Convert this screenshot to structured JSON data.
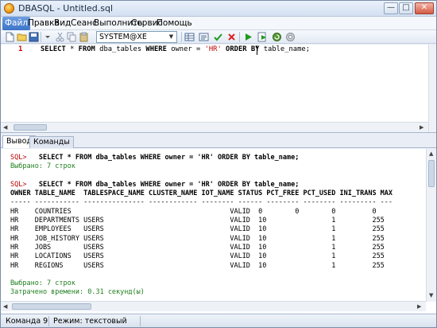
{
  "window": {
    "title": "DBASQL - Untitled.sql"
  },
  "menu": [
    "Файл",
    "Правка",
    "Вид",
    "Сеанс",
    "Выполнить",
    "Сервис",
    "Помощь"
  ],
  "toolbar": {
    "connection": "SYSTEM@XE"
  },
  "editor": {
    "line_number": "1",
    "code": {
      "select": "SELECT",
      "star": " * ",
      "from": "FROM",
      "table": " dba_tables ",
      "where": "WHERE",
      "cond": " owner = ",
      "literal": "'HR'",
      "order": " ORDER ",
      "by": "BY",
      "tail": " table_name;"
    }
  },
  "tabs": [
    {
      "label": "Вывод",
      "active": true
    },
    {
      "label": "Команды",
      "active": false
    }
  ],
  "output": {
    "lines": [
      {
        "type": "sql",
        "prompt": "SQL>",
        "text": "   SELECT * FROM dba_tables WHERE owner = 'HR' ORDER BY table_name;"
      },
      {
        "type": "info",
        "text": "Выбрано: 7 строк"
      },
      {
        "type": "blank",
        "text": ""
      },
      {
        "type": "sql",
        "prompt": "SQL>",
        "text": "   SELECT * FROM dba_tables WHERE owner = 'HR' ORDER BY table_name;"
      },
      {
        "type": "header",
        "text": "OWNER TABLE_NAME  TABLESPACE_NAME CLUSTER_NAME IOT_NAME STATUS PCT_FREE PCT_USED INI_TRANS MAX"
      },
      {
        "type": "row",
        "text": "----- ----------- --------------- ------------ -------- ------ -------- -------- --------- ---"
      },
      {
        "type": "row",
        "text": "HR    COUNTRIES                                       VALID  0        0        0         0"
      },
      {
        "type": "row",
        "text": "HR    DEPARTMENTS USERS                               VALID  10                1         255"
      },
      {
        "type": "row",
        "text": "HR    EMPLOYEES   USERS                               VALID  10                1         255"
      },
      {
        "type": "row",
        "text": "HR    JOB_HISTORY USERS                               VALID  10                1         255"
      },
      {
        "type": "row",
        "text": "HR    JOBS        USERS                               VALID  10                1         255"
      },
      {
        "type": "row",
        "text": "HR    LOCATIONS   USERS                               VALID  10                1         255"
      },
      {
        "type": "row",
        "text": "HR    REGIONS     USERS                               VALID  10                1         255"
      },
      {
        "type": "blank",
        "text": ""
      },
      {
        "type": "info",
        "text": "Выбрано: 7 строк"
      },
      {
        "type": "info",
        "text": "Затрачено времени: 0.31 секунд(ы)"
      }
    ]
  },
  "status": {
    "command": "Команда 9",
    "mode": "Режим: текстовый"
  },
  "colors": {
    "accent": "#3b73c7",
    "prompt": "#c00000",
    "info": "#208020"
  }
}
